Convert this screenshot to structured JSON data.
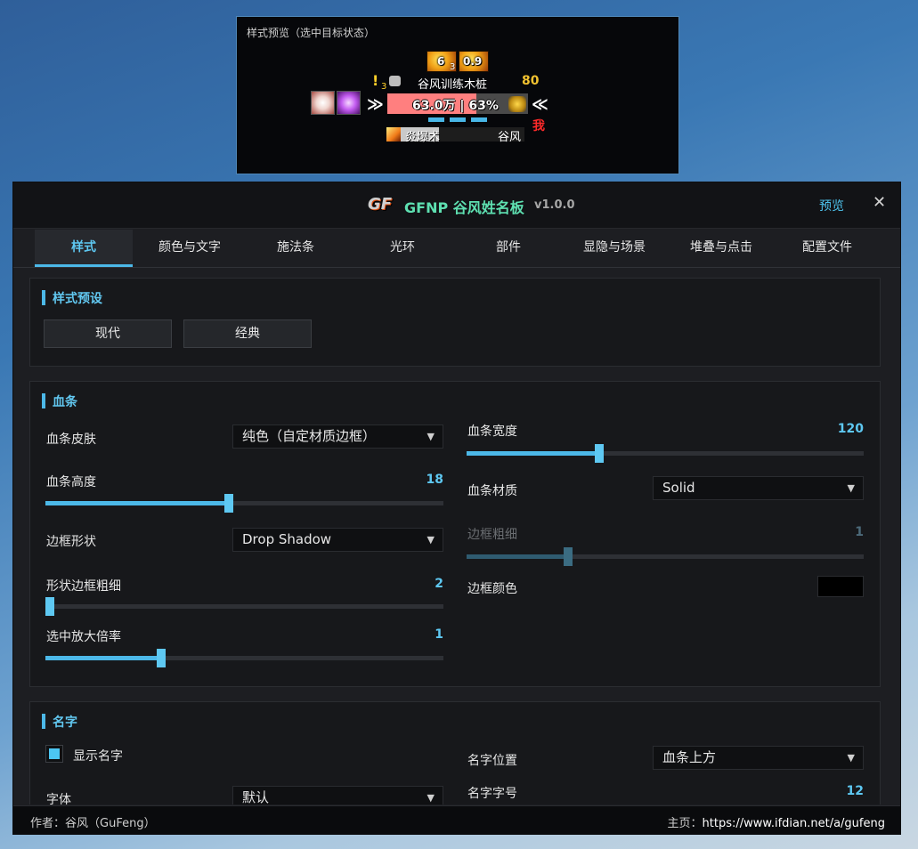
{
  "preview": {
    "title": "样式预览（选中目标状态）",
    "buff1_value": "6",
    "buff1_stack": "3",
    "buff2_value": "0.9",
    "quest_mark": "!",
    "quest_count": "3",
    "target_name": "谷风训练木桩",
    "target_level": "80",
    "hp_text": "63.0万 | 63%",
    "hp_percent": 0.63,
    "me_label": "我",
    "cast_spell": "炎爆术",
    "cast_target": "谷风",
    "cast_progress": 0.31
  },
  "window": {
    "logo": "GF",
    "title": "GFNP 谷风姓名板",
    "version": "v1.0.0",
    "preview_link": "预览",
    "close": "✕"
  },
  "tabs": [
    {
      "label": "样式",
      "active": true
    },
    {
      "label": "颜色与文字"
    },
    {
      "label": "施法条"
    },
    {
      "label": "光环"
    },
    {
      "label": "部件"
    },
    {
      "label": "显隐与场景"
    },
    {
      "label": "堆叠与点击"
    },
    {
      "label": "配置文件"
    }
  ],
  "style_presets": {
    "heading": "样式预设",
    "modern": "现代",
    "classic": "经典"
  },
  "healthbar": {
    "heading": "血条",
    "skin_label": "血条皮肤",
    "skin_value": "纯色（自定材质边框）",
    "height_label": "血条高度",
    "height_value": "18",
    "height_ratio": 0.46,
    "border_shape_label": "边框形状",
    "border_shape_value": "Drop Shadow",
    "shape_border_width_label": "形状边框粗细",
    "shape_border_width_value": "2",
    "shape_border_width_ratio": 0.0,
    "selected_scale_label": "选中放大倍率",
    "selected_scale_value": "1",
    "selected_scale_ratio": 0.29,
    "width_label": "血条宽度",
    "width_value": "120",
    "width_ratio": 0.335,
    "texture_label": "血条材质",
    "texture_value": "Solid",
    "border_width_label": "边框粗细",
    "border_width_value": "1",
    "border_width_ratio": 0.255,
    "border_color_label": "边框颜色",
    "border_color": "#000000"
  },
  "name_section": {
    "heading": "名字",
    "show_name_label": "显示名字",
    "show_name_checked": true,
    "name_position_label": "名字位置",
    "name_position_value": "血条上方",
    "name_size_label": "名字字号",
    "name_size_value": "12",
    "font_label": "字体",
    "font_value": "默认"
  },
  "footer": {
    "author": "作者：谷风（GuFeng）",
    "homepage_label": "主页：",
    "homepage_url": "https://www.ifdian.net/a/gufeng"
  },
  "colors": {
    "accent": "#4cb8e8",
    "title_green": "#5ee0b1",
    "level_gold": "#f2c230",
    "hp_red": "#ff7f7f"
  }
}
